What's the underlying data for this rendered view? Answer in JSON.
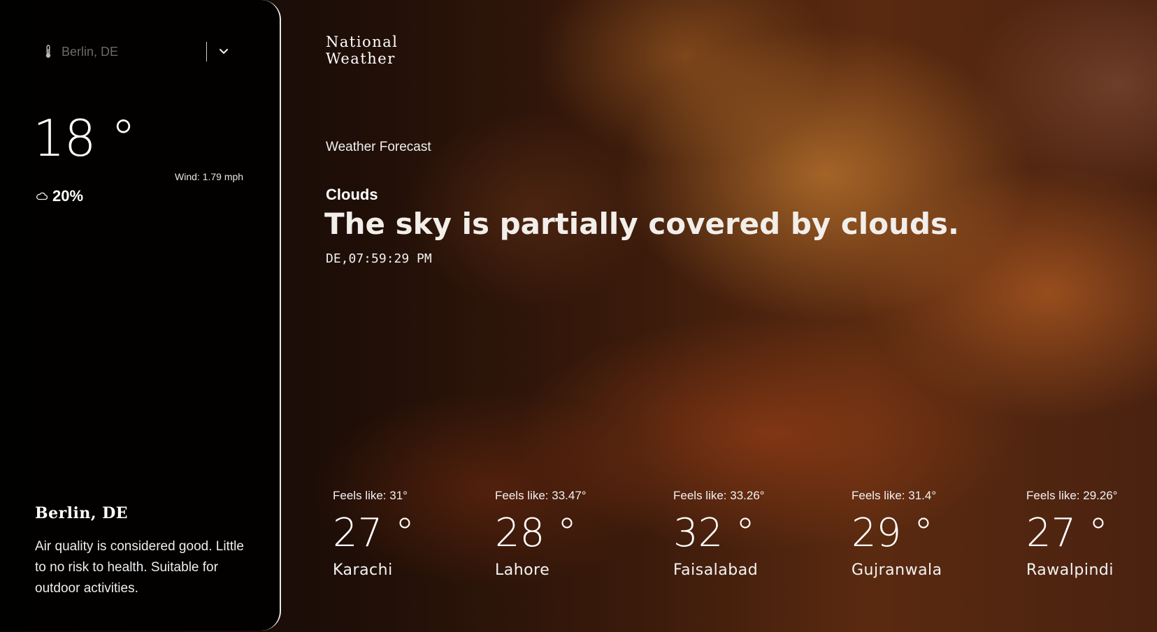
{
  "search": {
    "placeholder": "Berlin, DE",
    "icon": "thermometer-icon",
    "dropdown_icon": "chevron-down-icon"
  },
  "current": {
    "temperature": "18 °",
    "wind": "Wind: 1.79 mph",
    "humidity": "20%",
    "city": "Berlin, DE",
    "air_quality": "Air quality is considered good. Little to no risk to health. Suitable for outdoor activities."
  },
  "brand": {
    "title": "National\nWeather"
  },
  "main": {
    "section_label": "Weather Forecast",
    "condition": "Clouds",
    "description": "The sky is partially covered by clouds.",
    "timestamp": "DE,07:59:29 PM"
  },
  "cities": [
    {
      "feels": "Feels like: 31°",
      "temp": "27 °",
      "name": "Karachi"
    },
    {
      "feels": "Feels like: 33.47°",
      "temp": "28 °",
      "name": "Lahore"
    },
    {
      "feels": "Feels like: 33.26°",
      "temp": "32 °",
      "name": "Faisalabad"
    },
    {
      "feels": "Feels like: 31.4°",
      "temp": "29 °",
      "name": "Gujranwala"
    },
    {
      "feels": "Feels like: 29.26°",
      "temp": "27 °",
      "name": "Rawalpindi"
    }
  ],
  "colors": {
    "sidebar_border": "#e8e8e8",
    "text": "#ffffff",
    "placeholder": "#6a6a6a"
  }
}
